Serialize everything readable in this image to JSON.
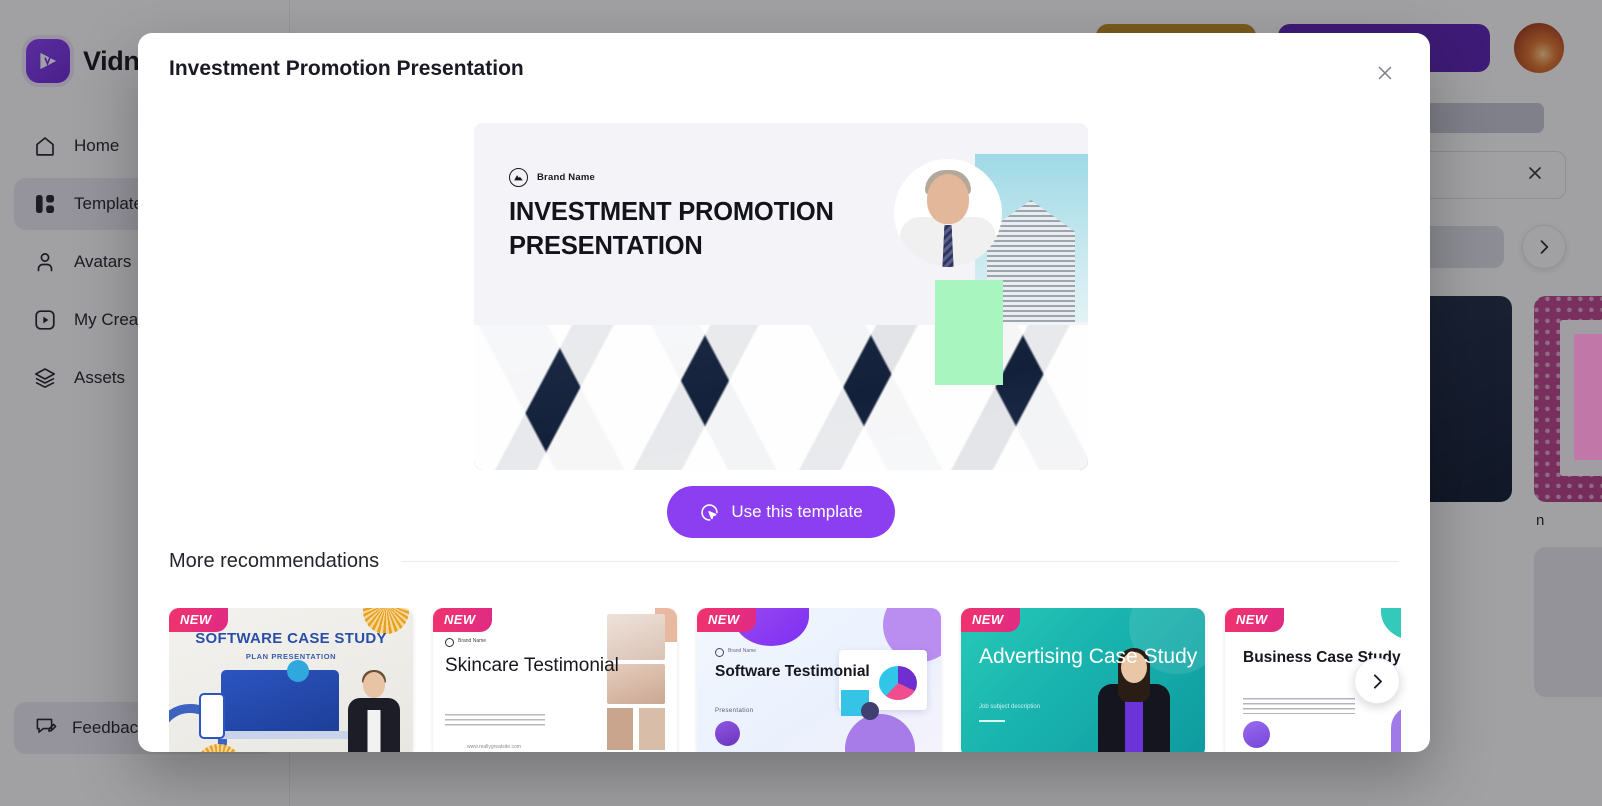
{
  "app": {
    "brand_name": "Vidnoz",
    "brand_logo_icon": "ai-play-logo-icon"
  },
  "sidebar": {
    "items": [
      {
        "label": "Home",
        "icon": "home-icon",
        "active": false
      },
      {
        "label": "Templates",
        "icon": "grid-blocks-icon",
        "active": true
      },
      {
        "label": "Avatars",
        "icon": "person-icon",
        "active": false
      },
      {
        "label": "My Creations",
        "icon": "play-square-icon",
        "active": false
      },
      {
        "label": "Assets",
        "icon": "layers-icon",
        "active": false
      }
    ],
    "feedback": {
      "label": "Feedback",
      "icon": "message-edit-icon"
    }
  },
  "background": {
    "search_clear_icon": "close-icon",
    "category_next_icon": "chevron-right-icon",
    "avatar_icon": "user-avatar",
    "cards": [
      {
        "caption": ""
      },
      {
        "caption": ""
      },
      {
        "caption": ""
      },
      {
        "caption": "n"
      }
    ]
  },
  "modal": {
    "title": "Investment Promotion Presentation",
    "close_icon": "close-icon",
    "preview_slide": {
      "brand_label": "Brand Name",
      "brand_mark_icon": "mountain-circle-icon",
      "heading": "INVESTMENT PROMOTION PRESENTATION",
      "photo_alt": "abstract white architecture",
      "avatar_alt": "presenter in white shirt and tie",
      "tower_alt": "office tower on teal sky"
    },
    "use_template_button": {
      "label": "Use this template",
      "icon": "cursor-circle-icon",
      "color": "#8b3ff0"
    },
    "recommendations": {
      "heading": "More recommendations",
      "next_icon": "chevron-right-icon",
      "badge_label": "NEW",
      "badge_color": "#f0336e",
      "items": [
        {
          "title": "SOFTWARE CASE STUDY",
          "subtitle": "PLAN PRESENTATION",
          "badge": "NEW"
        },
        {
          "title": "Skincare Testimonial",
          "brand_label": "Brand Name",
          "url_label": "www.reallygreatsite.com",
          "badge": "NEW"
        },
        {
          "title": "Software Testimonial",
          "subtitle": "Presentation",
          "brand_label": "Brand Name",
          "badge": "NEW"
        },
        {
          "title": "Advertising Case Study",
          "subtitle": "Job subject description",
          "badge": "NEW"
        },
        {
          "title": "Business Case Study",
          "badge": "NEW"
        },
        {
          "title": "",
          "badge": ""
        }
      ]
    }
  }
}
